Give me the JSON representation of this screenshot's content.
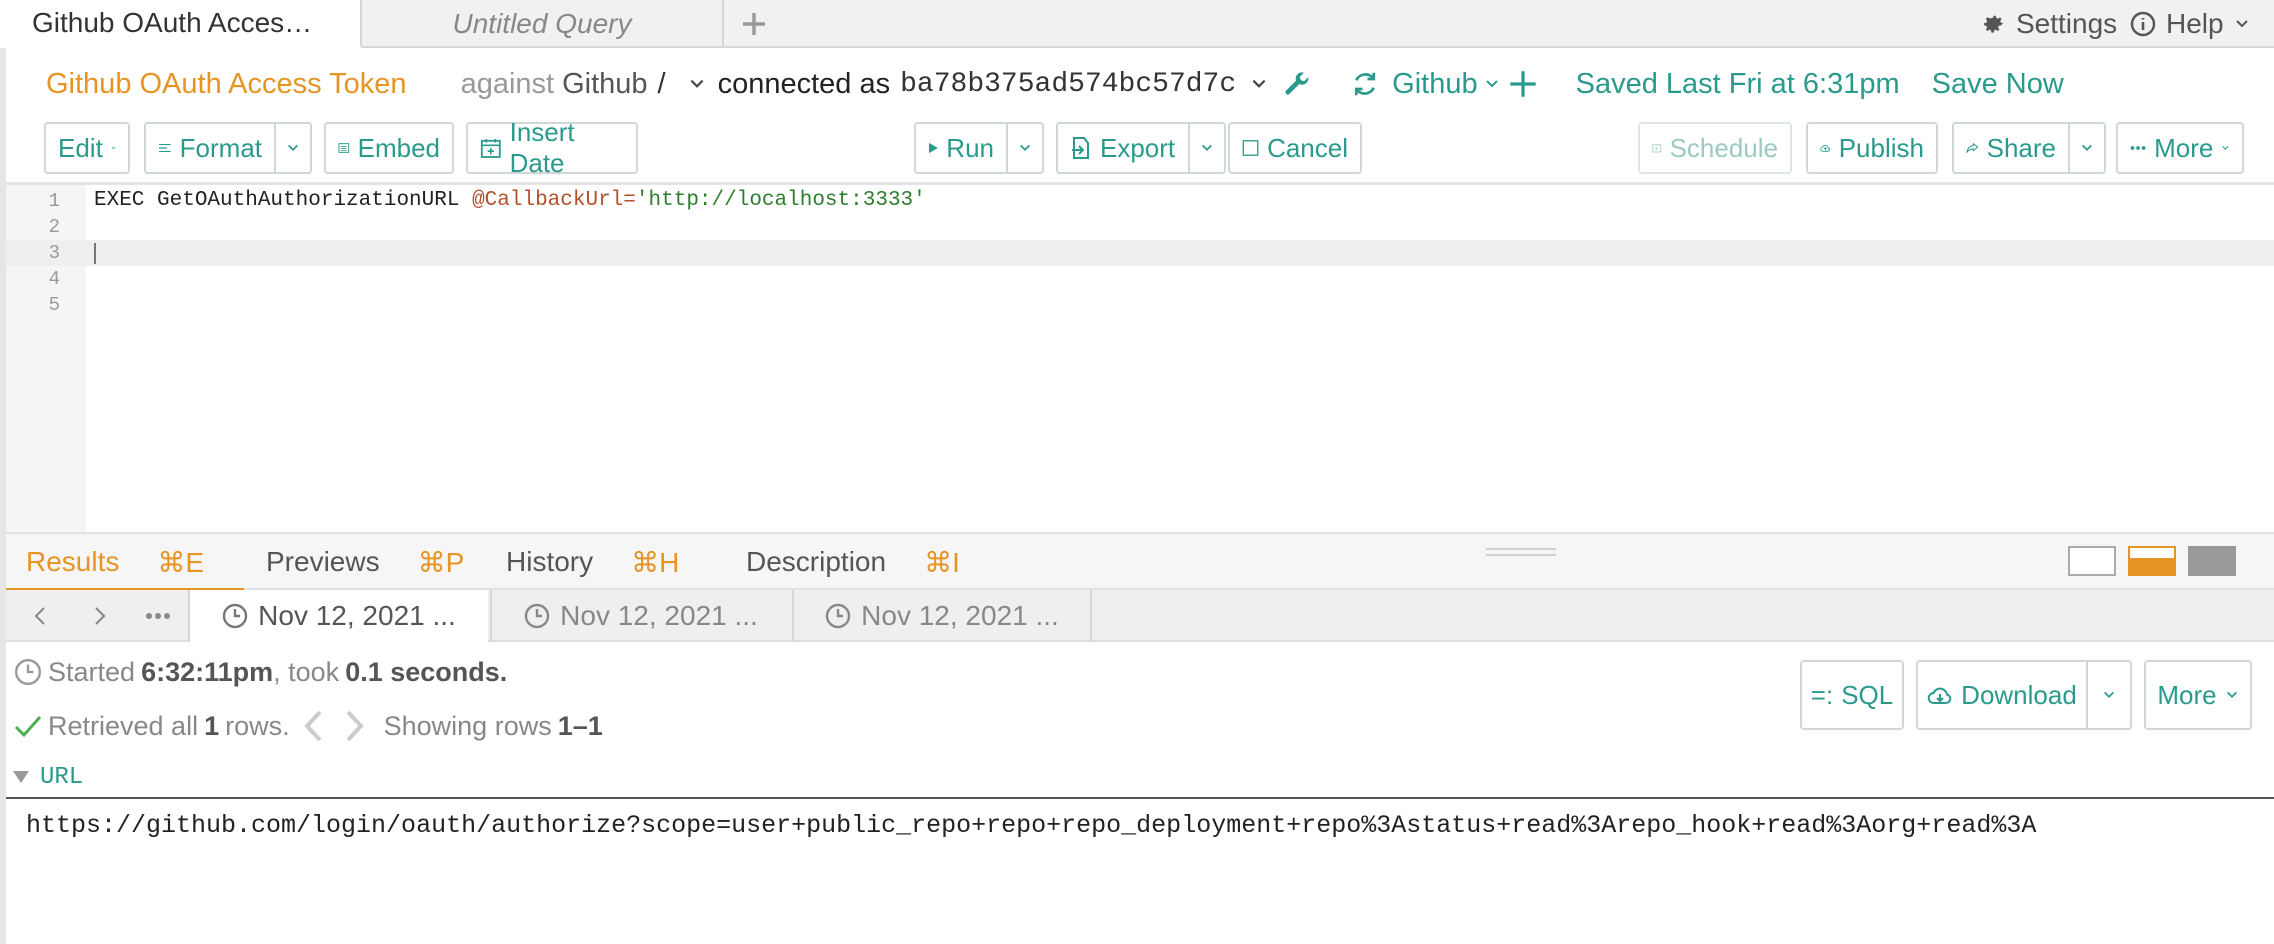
{
  "tabs": {
    "active": "Github OAuth Acces…",
    "inactive": "Untitled Query",
    "settings": "Settings",
    "help": "Help"
  },
  "header": {
    "title": "Github OAuth Access Token",
    "against": "against",
    "against_name": "Github",
    "slash": "/",
    "connected_as": "connected as",
    "connection_id": "ba78b375ad574bc57d7c",
    "datasource": "Github",
    "saved": "Saved Last Fri at 6:31pm",
    "save_now": "Save Now"
  },
  "toolbar": {
    "edit": "Edit",
    "format": "Format",
    "embed": "Embed",
    "insert_date": "Insert Date",
    "run": "Run",
    "export": "Export",
    "cancel": "Cancel",
    "schedule": "Schedule",
    "publish": "Publish",
    "share": "Share",
    "more": "More"
  },
  "editor": {
    "lines": [
      "1",
      "2",
      "3",
      "4",
      "5"
    ],
    "code": {
      "keyword": "EXEC GetOAuthAuthorizationURL ",
      "param": "@CallbackUrl",
      "eq": "=",
      "string": "'http://localhost:3333'"
    }
  },
  "results_tabs": [
    {
      "label": "Results",
      "key": "⌘E"
    },
    {
      "label": "Previews",
      "key": "⌘P"
    },
    {
      "label": "History",
      "key": "⌘H"
    },
    {
      "label": "Description",
      "key": "⌘I"
    }
  ],
  "runs": [
    "Nov 12, 2021 ...",
    "Nov 12, 2021 ...",
    "Nov 12, 2021 ..."
  ],
  "status": {
    "started_prefix": "Started",
    "started_time": "6:32:11pm",
    "took": ", took",
    "duration": "0.1 seconds.",
    "retrieved_prefix": "Retrieved all",
    "row_count": "1",
    "rows_suffix": "rows.",
    "showing_prefix": "Showing rows",
    "showing_range": "1–1"
  },
  "result_buttons": {
    "sql": "SQL",
    "sql_glyph": "=:",
    "download": "Download",
    "more": "More"
  },
  "result": {
    "column": "URL",
    "value": "https://github.com/login/oauth/authorize?scope=user+public_repo+repo+repo_deployment+repo%3Astatus+read%3Arepo_hook+read%3Aorg+read%3A"
  },
  "colors": {
    "accent_orange": "#e69525",
    "accent_teal": "#2a9a8c"
  }
}
